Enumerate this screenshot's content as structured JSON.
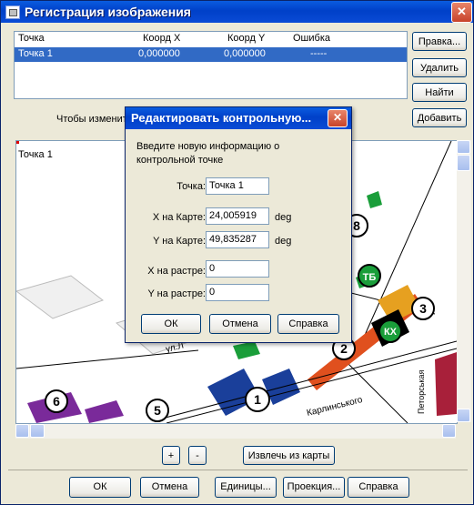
{
  "window": {
    "title": "Регистрация изображения",
    "close_glyph": "✕"
  },
  "table": {
    "headers": [
      "Точка",
      "Коорд X",
      "Коорд Y",
      "Ошибка"
    ],
    "rows": [
      [
        "Точка 1",
        "0,000000",
        "0,000000",
        "-----"
      ]
    ]
  },
  "side_buttons": {
    "edit": "Правка...",
    "delete": "Удалить",
    "find": "Найти",
    "add": "Добавить"
  },
  "hint_text": "Чтобы изменит",
  "map": {
    "point_label": "Точка 1",
    "street_labels": [
      "ул.Л",
      "Карлинського",
      "Петорськая"
    ],
    "badges": [
      "1",
      "2",
      "3",
      "5",
      "6",
      "8",
      "ТБ",
      "КХ"
    ]
  },
  "zoom": {
    "plus": "+",
    "minus": "-",
    "extract": "Извлечь из карты"
  },
  "bottom_buttons": {
    "ok": "ОК",
    "cancel": "Отмена",
    "units": "Единицы...",
    "projection": "Проекция...",
    "help": "Справка"
  },
  "dialog": {
    "title": "Редактировать контрольную...",
    "intro": "Введите новую информацию о контрольной точке",
    "point_label": "Точка:",
    "point_value": "Точка 1",
    "x_map_label": "X на Карте:",
    "x_map_value": "24,005919",
    "x_map_unit": "deg",
    "y_map_label": "Y на Карте:",
    "y_map_value": "49,835287",
    "y_map_unit": "deg",
    "x_raster_label": "X на растре:",
    "x_raster_value": "0",
    "y_raster_label": "Y на растре:",
    "y_raster_value": "0",
    "ok": "ОК",
    "cancel": "Отмена",
    "help": "Справка"
  }
}
